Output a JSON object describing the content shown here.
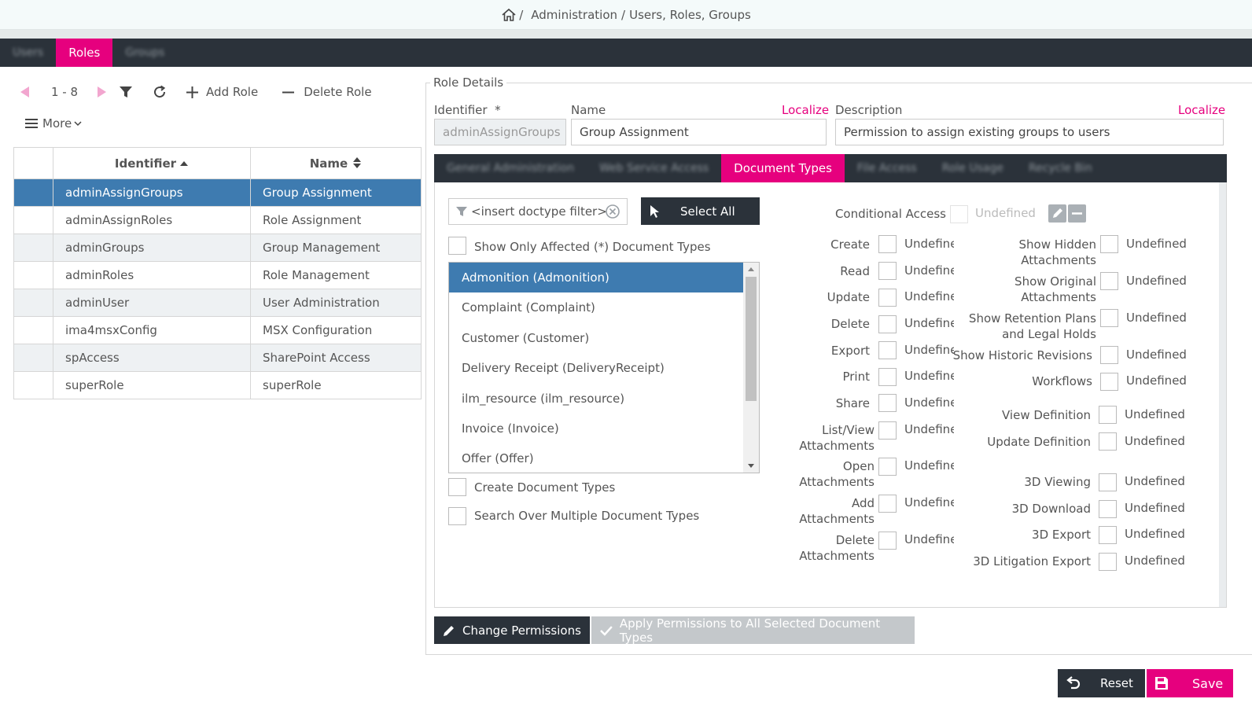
{
  "breadcrumb": {
    "separator": "/",
    "items": [
      "Administration",
      "Users, Roles, Groups"
    ],
    "sep2": "/"
  },
  "topTabs": [
    "Users",
    "Roles",
    "Groups"
  ],
  "toolbar": {
    "range": "1 - 8",
    "add": "Add Role",
    "delete": "Delete Role",
    "more": "More"
  },
  "grid": {
    "headers": {
      "identifier": "Identifier",
      "name": "Name"
    },
    "rows": [
      {
        "id": "adminAssignGroups",
        "name": "Group Assignment"
      },
      {
        "id": "adminAssignRoles",
        "name": "Role Assignment"
      },
      {
        "id": "adminGroups",
        "name": "Group Management"
      },
      {
        "id": "adminRoles",
        "name": "Role Management"
      },
      {
        "id": "adminUser",
        "name": "User Administration"
      },
      {
        "id": "ima4msxConfig",
        "name": "MSX Configuration"
      },
      {
        "id": "spAccess",
        "name": "SharePoint Access"
      },
      {
        "id": "superRole",
        "name": "superRole"
      }
    ]
  },
  "details": {
    "legend": "Role Details",
    "identifierLabel": "Identifier",
    "required": "*",
    "nameLabel": "Name",
    "descLabel": "Description",
    "localize": "Localize",
    "identifierValue": "adminAssignGroups",
    "nameValue": "Group Assignment",
    "descValue": "Permission to assign existing groups to users"
  },
  "panelTabs": [
    "General Administration",
    "Web Service Access",
    "Document Types",
    "File Access",
    "Role Usage",
    "Recycle Bin"
  ],
  "doctype": {
    "filterPlaceholder": "<insert doctype filter>",
    "selectAll": "Select All",
    "showOnly": "Show Only Affected (*) Document Types",
    "items": [
      "Admonition (Admonition)",
      "Complaint (Complaint)",
      "Customer (Customer)",
      "Delivery Receipt (DeliveryReceipt)",
      "ilm_resource (ilm_resource)",
      "Invoice (Invoice)",
      "Offer (Offer)"
    ],
    "createDocTypes": "Create Document Types",
    "searchMulti": "Search Over Multiple Document Types"
  },
  "perms": {
    "conditional": "Conditional Access",
    "undefined": "Undefined",
    "truncated": "Undefine",
    "left": [
      "Create",
      "Read",
      "Update",
      "Delete",
      "Export",
      "Print",
      "Share",
      "List/View Attachments",
      "Open Attachments",
      "Add Attachments",
      "Delete Attachments"
    ],
    "right": [
      "Show Hidden Attachments",
      "Show Original Attachments",
      "Show Retention Plans and Legal Holds",
      "Show Historic Revisions",
      "Workflows",
      "View Definition",
      "Update Definition",
      "3D Viewing",
      "3D Download",
      "3D Export",
      "3D Litigation Export"
    ]
  },
  "actions": {
    "change": "Change Permissions",
    "apply": "Apply Permissions to All Selected Document Types",
    "reset": "Reset",
    "save": "Save"
  },
  "colors": {
    "accent": "#e6007e",
    "dark": "#2b323a",
    "selected": "#3e7bb0"
  }
}
